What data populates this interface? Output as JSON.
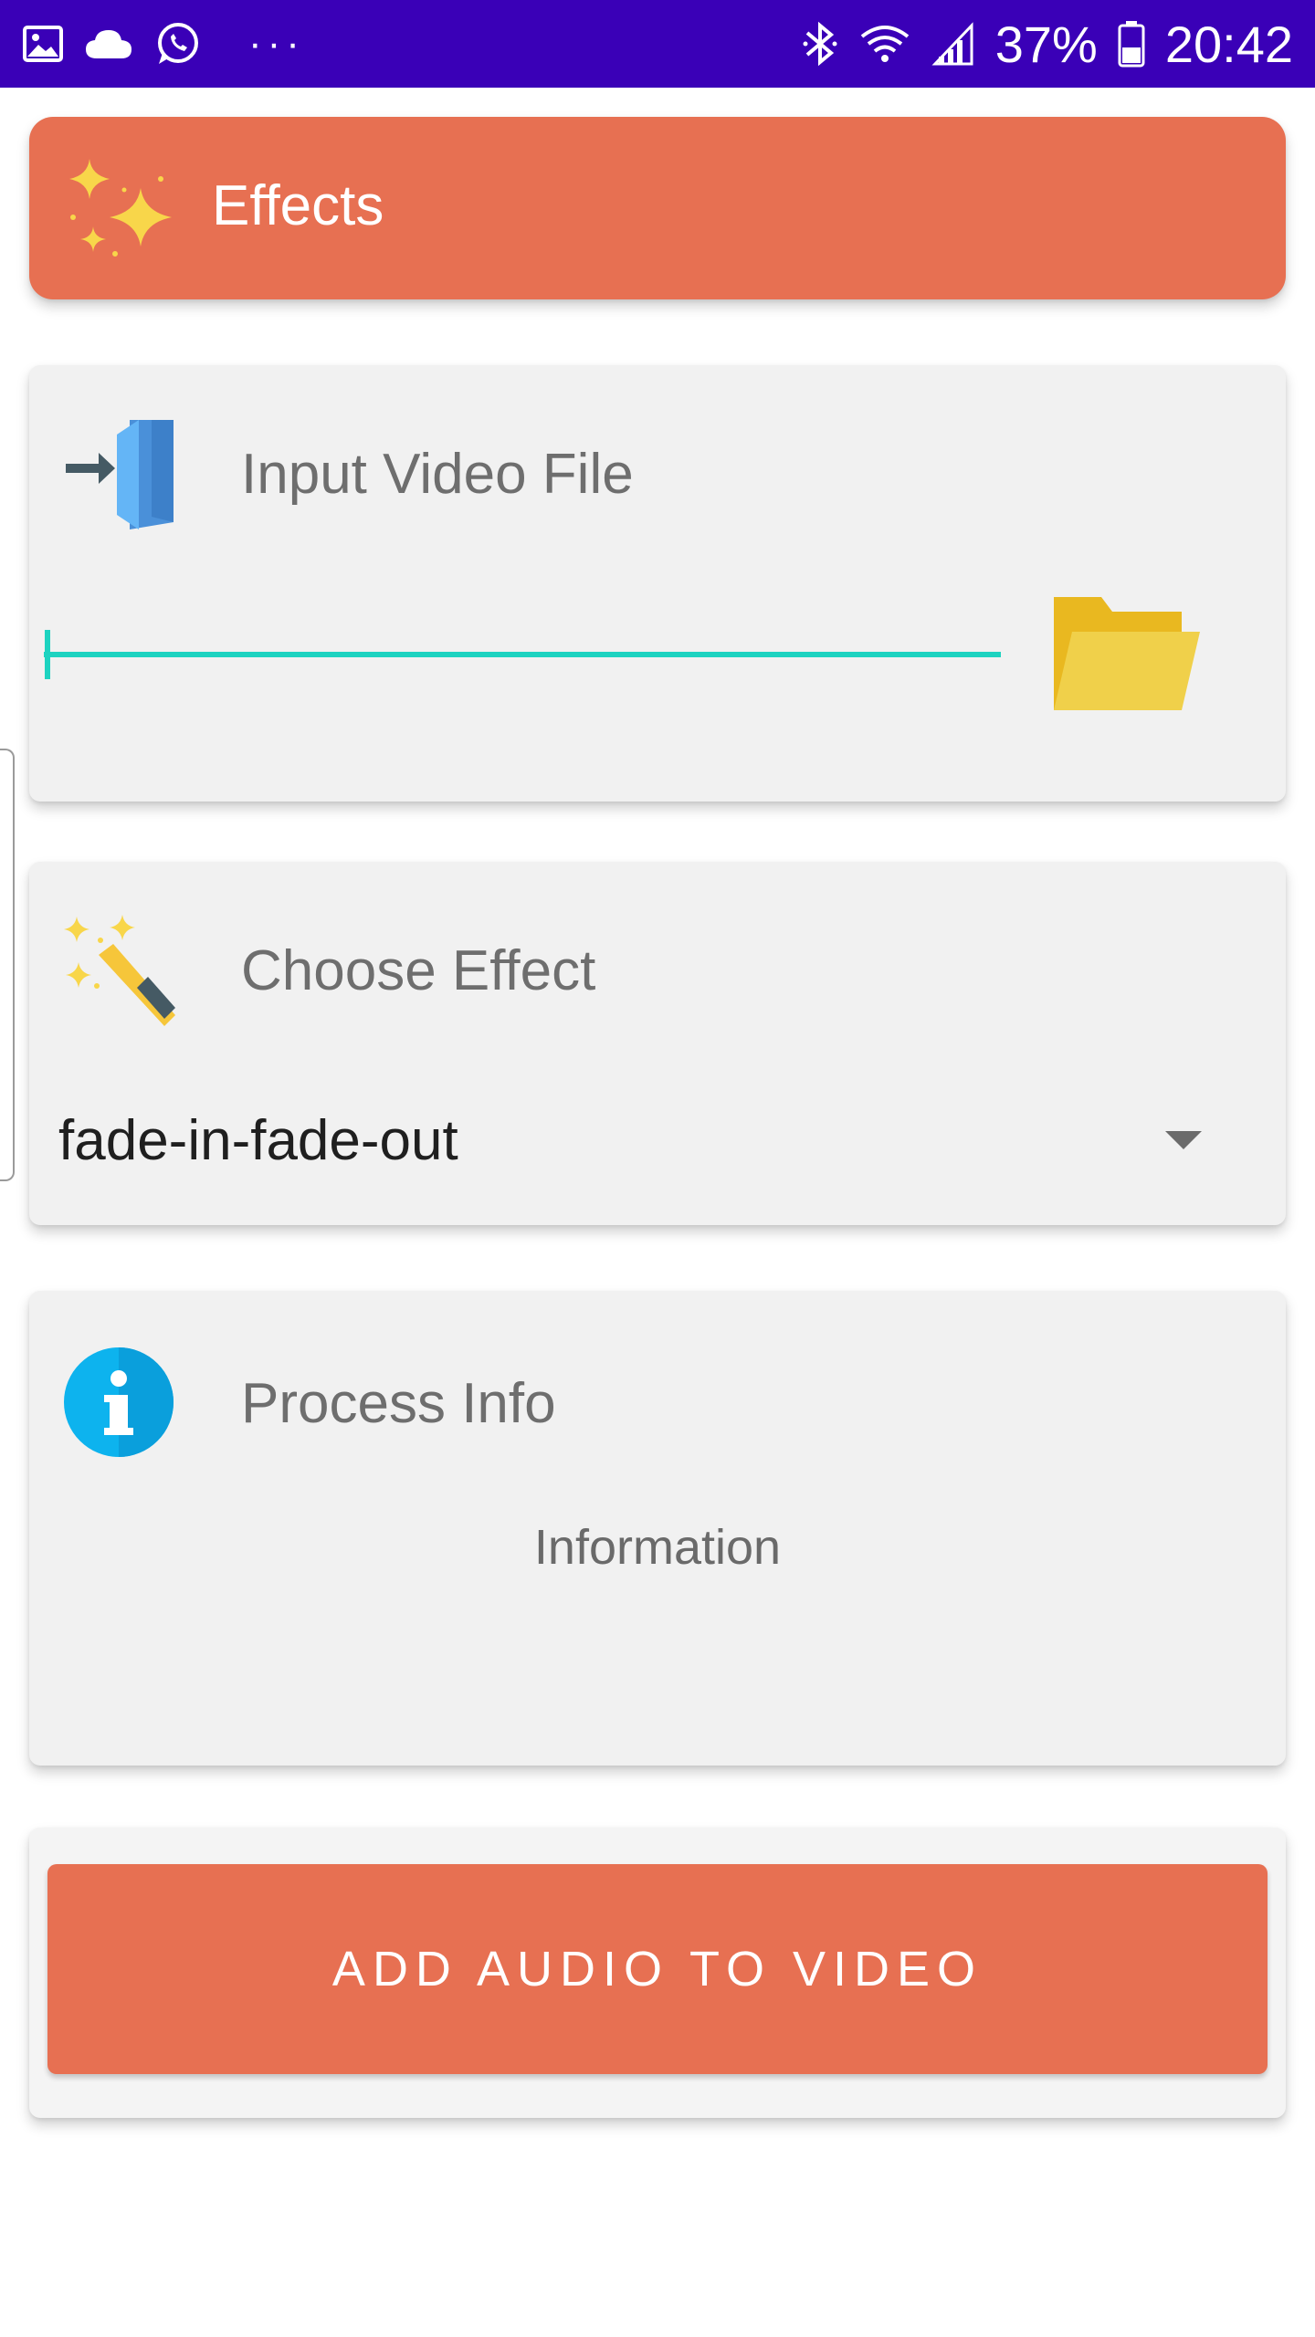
{
  "status_bar": {
    "left_icons": [
      "image-icon",
      "cloud-icon",
      "whatsapp-icon"
    ],
    "more": "···",
    "battery_percent": "37%",
    "time": "20:42",
    "background": "#3a00b7"
  },
  "header": {
    "title": "Effects",
    "icon": "sparkles-icon",
    "accent": "#e77052"
  },
  "input_card": {
    "title": "Input Video File",
    "icon": "input-file-icon",
    "value": "",
    "browse_icon": "folder-icon",
    "underline_color": "#1dd3c0"
  },
  "effect_card": {
    "title": "Choose Effect",
    "icon": "magic-wand-icon",
    "selected": "fade-in-fade-out"
  },
  "info_card": {
    "title": "Process Info",
    "icon": "info-icon",
    "text": "Information"
  },
  "action": {
    "label": "ADD AUDIO TO VIDEO"
  }
}
